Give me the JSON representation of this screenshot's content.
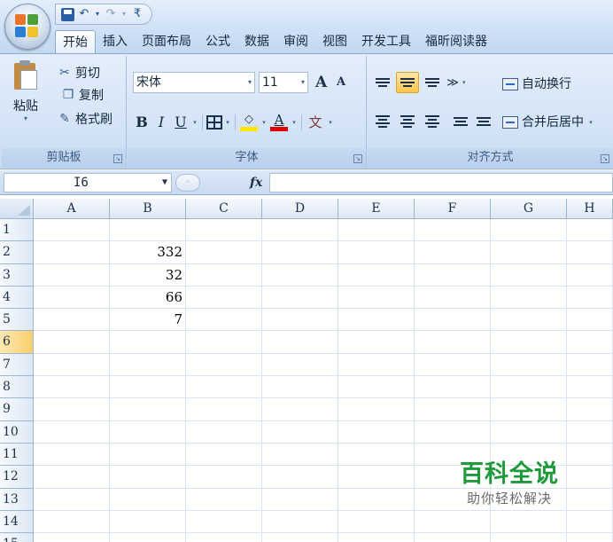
{
  "quick_access": {
    "icons": [
      "save-icon",
      "undo-icon",
      "redo-icon",
      "customize-icon"
    ],
    "save_glyph": "",
    "undo_glyph": "↶",
    "redo_glyph": "↷",
    "drop_glyph": "▾",
    "customize_glyph": "₹"
  },
  "tabs": [
    {
      "label": "开始",
      "active": true
    },
    {
      "label": "插入"
    },
    {
      "label": "页面布局"
    },
    {
      "label": "公式"
    },
    {
      "label": "数据"
    },
    {
      "label": "审阅"
    },
    {
      "label": "视图"
    },
    {
      "label": "开发工具"
    },
    {
      "label": "福昕阅读器"
    }
  ],
  "ribbon": {
    "clipboard": {
      "paste_label": "粘贴",
      "cut_label": "剪切",
      "copy_label": "复制",
      "format_painter_label": "格式刷",
      "group_label": "剪贴板"
    },
    "font": {
      "font_name": "宋体",
      "font_size": "11",
      "grow_glyph": "A",
      "shrink_glyph": "A",
      "bold": "B",
      "italic": "I",
      "underline": "U",
      "font_color_glyph": "A",
      "fill_color_glyph": "◇",
      "phonetic_glyph": "文",
      "fill_color": "#ffe600",
      "font_color": "#e00000",
      "group_label": "字体"
    },
    "alignment": {
      "wrap_text_label": "自动换行",
      "merge_center_label": "合并后居中",
      "orientation_glyph": "≫",
      "group_label": "对齐方式"
    }
  },
  "formula_bar": {
    "name_box": "I6",
    "fx_label": "fx",
    "formula": ""
  },
  "sheet": {
    "columns": [
      "A",
      "B",
      "C",
      "D",
      "E",
      "F",
      "G",
      "H"
    ],
    "rows": [
      {
        "n": "1",
        "cells": [
          "",
          "",
          "",
          "",
          "",
          "",
          "",
          ""
        ]
      },
      {
        "n": "2",
        "cells": [
          "",
          "332",
          "",
          "",
          "",
          "",
          "",
          ""
        ]
      },
      {
        "n": "3",
        "cells": [
          "",
          "32",
          "",
          "",
          "",
          "",
          "",
          ""
        ]
      },
      {
        "n": "4",
        "cells": [
          "",
          "66",
          "",
          "",
          "",
          "",
          "",
          ""
        ]
      },
      {
        "n": "5",
        "cells": [
          "",
          "7",
          "",
          "",
          "",
          "",
          "",
          ""
        ]
      },
      {
        "n": "6",
        "cells": [
          "",
          "",
          "",
          "",
          "",
          "",
          "",
          ""
        ],
        "selected": true
      },
      {
        "n": "7",
        "cells": [
          "",
          "",
          "",
          "",
          "",
          "",
          "",
          ""
        ]
      },
      {
        "n": "8",
        "cells": [
          "",
          "",
          "",
          "",
          "",
          "",
          "",
          ""
        ]
      },
      {
        "n": "9",
        "cells": [
          "",
          "",
          "",
          "",
          "",
          "",
          "",
          ""
        ]
      },
      {
        "n": "10",
        "cells": [
          "",
          "",
          "",
          "",
          "",
          "",
          "",
          ""
        ]
      },
      {
        "n": "11",
        "cells": [
          "",
          "",
          "",
          "",
          "",
          "",
          "",
          ""
        ]
      },
      {
        "n": "12",
        "cells": [
          "",
          "",
          "",
          "",
          "",
          "",
          "",
          ""
        ]
      },
      {
        "n": "13",
        "cells": [
          "",
          "",
          "",
          "",
          "",
          "",
          "",
          ""
        ]
      },
      {
        "n": "14",
        "cells": [
          "",
          "",
          "",
          "",
          "",
          "",
          "",
          ""
        ]
      },
      {
        "n": "15",
        "cells": [
          "",
          "",
          "",
          "",
          "",
          "",
          "",
          ""
        ]
      }
    ]
  },
  "watermark": {
    "title": "百科全说",
    "subtitle": "助你轻松解决"
  }
}
